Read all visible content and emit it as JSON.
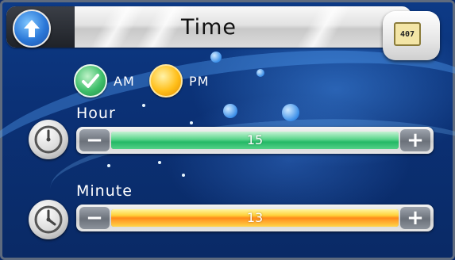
{
  "title": "Time",
  "header": {
    "back_icon": "up-arrow-icon",
    "remote_icon": "tv-remote-icon",
    "remote_display": "407"
  },
  "meridiem": {
    "options": [
      {
        "label": "AM",
        "selected": true,
        "color": "#3fbf6a"
      },
      {
        "label": "PM",
        "selected": false,
        "color": "#ffbf1a"
      }
    ]
  },
  "hour": {
    "label": "Hour",
    "value": "15",
    "fill_fraction": 1.0,
    "icon": "clock-icon",
    "decrement_label": "−",
    "increment_label": "+"
  },
  "minute": {
    "label": "Minute",
    "value": "13",
    "fill_fraction": 1.0,
    "icon": "clock-icon",
    "decrement_label": "−",
    "increment_label": "+"
  },
  "colors": {
    "background": "#0b3176",
    "hour_fill": "#24b866",
    "minute_fill": "#ffbf1a"
  }
}
